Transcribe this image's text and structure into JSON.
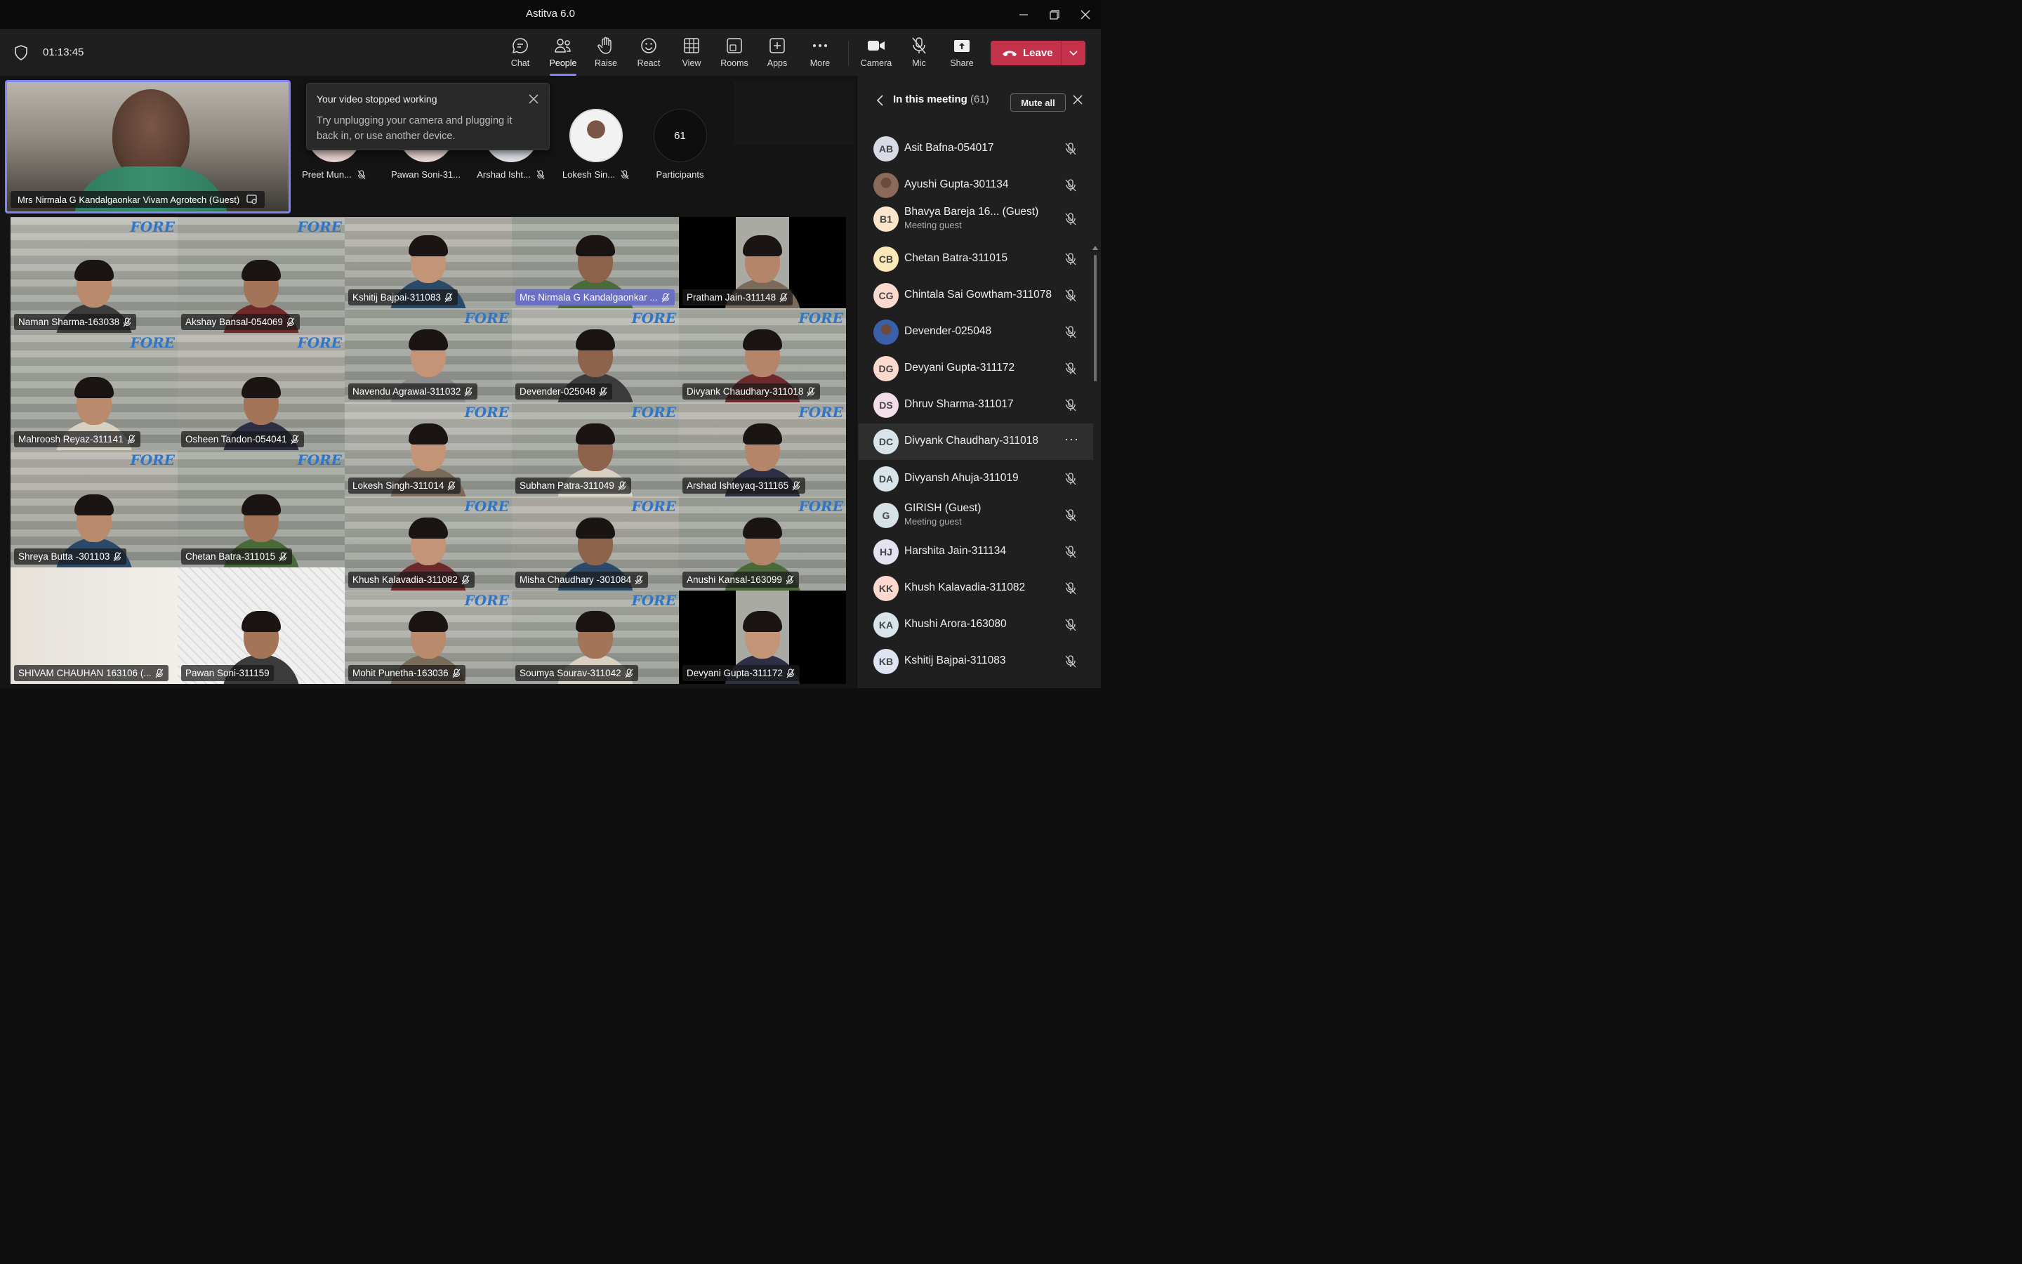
{
  "window": {
    "title": "Astitva 6.0"
  },
  "meeting": {
    "timer": "01:13:45"
  },
  "toolbar": {
    "chat": "Chat",
    "people": "People",
    "raise": "Raise",
    "react": "React",
    "view": "View",
    "rooms": "Rooms",
    "apps": "Apps",
    "more": "More",
    "camera": "Camera",
    "mic": "Mic",
    "share": "Share",
    "leave": "Leave"
  },
  "spotlight": {
    "name": "Mrs Nirmala G Kandalgaonkar Vivam Agrotech (Guest)"
  },
  "toast": {
    "title": "Your video stopped working",
    "body": "Try unplugging your camera and plugging it back in, or use another device."
  },
  "strip": [
    {
      "name": "Preet Mun..."
    },
    {
      "name": "Pawan Soni-31..."
    },
    {
      "name": "Arshad Isht..."
    },
    {
      "name": "Lokesh Sin..."
    }
  ],
  "participants_count": "61",
  "participants_label": "Participants",
  "grid": [
    "Naman Sharma-163038",
    "Akshay Bansal-054069",
    "Kshitij Bajpai-311083",
    "Mrs Nirmala G Kandalgaonkar ...",
    "Pratham Jain-311148",
    "Mahroosh Reyaz-311141",
    "Osheen Tandon-054041",
    "Navendu Agrawal-311032",
    "Devender-025048",
    "Divyank Chaudhary-311018",
    "Shreya Butta -301103",
    "Chetan Batra-311015",
    "Lokesh Singh-311014",
    "Subham Patra-311049",
    "Arshad Ishteyaq-311165",
    "SHIVAM CHAUHAN 163106 (...",
    "Pawan Soni-311159",
    "Khush Kalavadia-311082",
    "Misha Chaudhary -301084",
    "Anushi Kansal-163099",
    "Mohit Punetha-163036",
    "Soumya Sourav-311042",
    "Devyani Gupta-311172"
  ],
  "panel": {
    "title": "In this meeting",
    "count": "(61)",
    "mute_all": "Mute all",
    "people": [
      {
        "initials": "AB",
        "name": "Asit Bafna-054017",
        "sub": "",
        "color": "#d7dbe6"
      },
      {
        "initials": "",
        "name": "Ayushi Gupta-301134",
        "sub": "",
        "color": "#8a6a58"
      },
      {
        "initials": "B1",
        "name": "Bhavya Bareja 16... (Guest)",
        "sub": "Meeting guest",
        "color": "#fbe6cc"
      },
      {
        "initials": "CB",
        "name": "Chetan Batra-311015",
        "sub": "",
        "color": "#fbe8b8"
      },
      {
        "initials": "CG",
        "name": "Chintala Sai Gowtham-311078",
        "sub": "",
        "color": "#fbd9cf"
      },
      {
        "initials": "",
        "name": "Devender-025048",
        "sub": "",
        "color": "#3b5fa8"
      },
      {
        "initials": "DG",
        "name": "Devyani Gupta-311172",
        "sub": "",
        "color": "#fbd9cf"
      },
      {
        "initials": "DS",
        "name": "Dhruv Sharma-311017",
        "sub": "",
        "color": "#f3dde8"
      },
      {
        "initials": "DC",
        "name": "Divyank Chaudhary-311018",
        "sub": "",
        "color": "#d8e4ea"
      },
      {
        "initials": "DA",
        "name": "Divyansh Ahuja-311019",
        "sub": "",
        "color": "#d8e4ea"
      },
      {
        "initials": "G",
        "name": "GIRISH (Guest)",
        "sub": "Meeting guest",
        "color": "#d7e2e6"
      },
      {
        "initials": "HJ",
        "name": "Harshita Jain-311134",
        "sub": "",
        "color": "#e2e2f1"
      },
      {
        "initials": "KK",
        "name": "Khush Kalavadia-311082",
        "sub": "",
        "color": "#fbd9cf"
      },
      {
        "initials": "KA",
        "name": "Khushi Arora-163080",
        "sub": "",
        "color": "#d8e4ea"
      },
      {
        "initials": "KB",
        "name": "Kshitij Bajpai-311083",
        "sub": "",
        "color": "#dfe4f3"
      }
    ]
  }
}
